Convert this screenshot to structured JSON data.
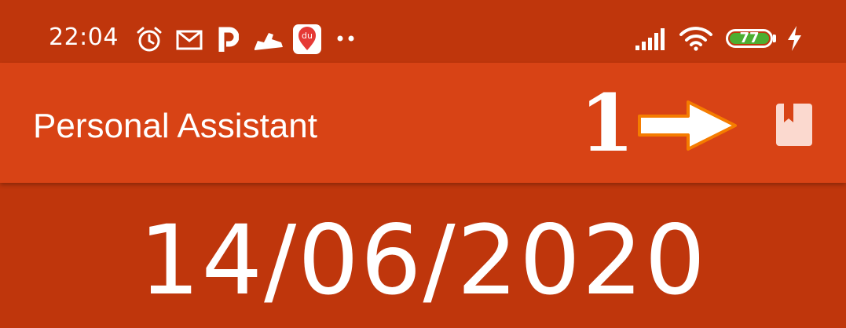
{
  "status_bar": {
    "time": "22:04",
    "icons": [
      "alarm-icon",
      "mail-icon",
      "p-app-icon",
      "shoe-icon",
      "du-map-icon",
      "more-dots-icon",
      "signal-icon",
      "wifi-icon",
      "battery-icon",
      "charging-icon"
    ],
    "battery_level": "77",
    "du_badge": "du"
  },
  "app_bar": {
    "title": "Personal Assistant",
    "annotation_number": "1",
    "action_icon": "bookmark-icon"
  },
  "main": {
    "date": "14/06/2020"
  },
  "colors": {
    "status_bar": "#bf360c",
    "app_bar": "#d84315",
    "background": "#bf360c",
    "battery_fill": "#4cae31",
    "arrow_outline": "#f57c00"
  }
}
